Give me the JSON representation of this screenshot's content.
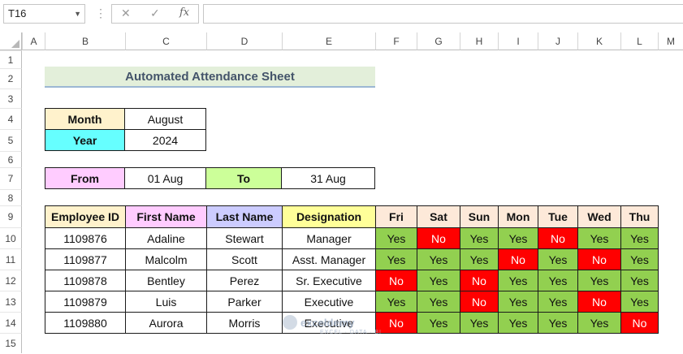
{
  "formula_bar": {
    "name_box": "T16",
    "cancel_icon": "✕",
    "enter_icon": "✓",
    "fx_label": "fx",
    "formula": ""
  },
  "columns": [
    "A",
    "B",
    "C",
    "D",
    "E",
    "F",
    "G",
    "H",
    "I",
    "J",
    "K",
    "L",
    "M"
  ],
  "rows": [
    "1",
    "2",
    "3",
    "4",
    "5",
    "6",
    "7",
    "8",
    "9",
    "10",
    "11",
    "12",
    "13",
    "14",
    "15"
  ],
  "title": "Automated Attendance Sheet",
  "month_label": "Month",
  "month_value": "August",
  "year_label": "Year",
  "year_value": "2024",
  "from_label": "From",
  "from_value": "01 Aug",
  "to_label": "To",
  "to_value": "31 Aug",
  "table": {
    "headers": [
      "Employee ID",
      "First Name",
      "Last Name",
      "Designation"
    ],
    "days": [
      "Fri",
      "Sat",
      "Sun",
      "Mon",
      "Tue",
      "Wed",
      "Thu"
    ],
    "rows": [
      {
        "id": "1109876",
        "first": "Adaline",
        "last": "Stewart",
        "designation": "Manager",
        "attendance": [
          "Yes",
          "No",
          "Yes",
          "Yes",
          "No",
          "Yes",
          "Yes"
        ]
      },
      {
        "id": "1109877",
        "first": "Malcolm",
        "last": "Scott",
        "designation": "Asst. Manager",
        "attendance": [
          "Yes",
          "Yes",
          "Yes",
          "No",
          "Yes",
          "No",
          "Yes"
        ]
      },
      {
        "id": "1109878",
        "first": "Bentley",
        "last": "Perez",
        "designation": "Sr. Executive",
        "attendance": [
          "No",
          "Yes",
          "No",
          "Yes",
          "Yes",
          "Yes",
          "Yes"
        ]
      },
      {
        "id": "1109879",
        "first": "Luis",
        "last": "Parker",
        "designation": "Executive",
        "attendance": [
          "Yes",
          "Yes",
          "No",
          "Yes",
          "Yes",
          "No",
          "Yes"
        ]
      },
      {
        "id": "1109880",
        "first": "Aurora",
        "last": "Morris",
        "designation": "Executive",
        "attendance": [
          "No",
          "Yes",
          "Yes",
          "Yes",
          "Yes",
          "Yes",
          "No"
        ]
      }
    ]
  },
  "colors": {
    "month_bg": "#fff2cc",
    "year_bg": "#66ffff",
    "from_bg": "#ffccff",
    "to_bg": "#ccff99",
    "hdr_id": "#fff2cc",
    "hdr_first": "#ffccff",
    "hdr_last": "#ccccff",
    "hdr_desig": "#ffff99",
    "hdr_day": "#fde9d9",
    "yes": "#92d050",
    "no": "#ff0000"
  },
  "watermark": {
    "brand": "exceldemy",
    "tagline": "EXCEL · DATA · BI"
  }
}
